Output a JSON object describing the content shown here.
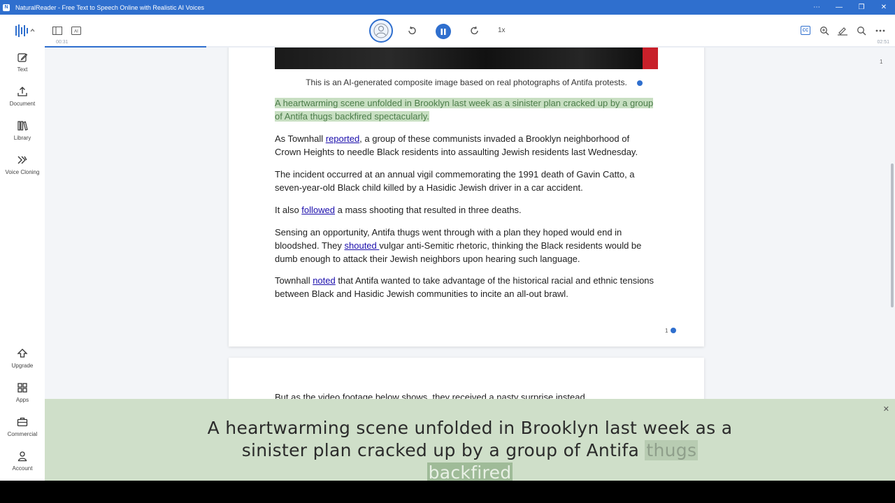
{
  "window": {
    "title": "NaturalReader - Free Text to Speech Online with Realistic AI Voices",
    "app_icon": "N",
    "controls": [
      "⋯",
      "—",
      "❐",
      "✕"
    ]
  },
  "toolbar": {
    "time_elapsed": "00:31",
    "time_total": "02:51",
    "speed": "1x",
    "cc_label": "CC",
    "ai_label": "AI",
    "progress_percent": 19
  },
  "sidebar": {
    "items": [
      {
        "label": "Text",
        "icon": "✎"
      },
      {
        "label": "Document",
        "icon": "⇪"
      },
      {
        "label": "Library",
        "icon": "▥"
      },
      {
        "label": "Voice Cloning",
        "icon": "≫"
      }
    ],
    "bottom_items": [
      {
        "label": "Upgrade",
        "icon": "⇧"
      },
      {
        "label": "Apps",
        "icon": "▦"
      },
      {
        "label": "Commercial",
        "icon": "▣"
      },
      {
        "label": "Account",
        "icon": "◯"
      }
    ]
  },
  "document": {
    "caption": "This is an AI-generated composite image based on real photographs of Antifa protests.",
    "paragraphs": [
      {
        "text": "A heartwarming scene unfolded in Brooklyn last week as a sinister plan cracked up by a group of Antifa thugs backfired spectacularly."
      },
      {
        "pre": "As Townhall ",
        "link": "reported",
        "post": ", a group of these communists invaded a Brooklyn neighborhood of Crown Heights to needle Black residents into assaulting Jewish residents last Wednesday."
      },
      {
        "text": "The incident occurred at an annual vigil commemorating the 1991 death of Gavin Catto, a seven-year-old Black child killed by a Hasidic Jewish driver in a car accident."
      },
      {
        "pre": "It also ",
        "link": "followed",
        "post": " a mass shooting that resulted in three deaths."
      },
      {
        "pre": "Sensing an opportunity, Antifa thugs went through with a plan they hoped would end in bloodshed. They ",
        "link": "shouted ",
        "post": "vulgar anti-Semitic rhetoric, thinking the Black residents would be dumb enough to attack their Jewish neighbors upon hearing such language."
      },
      {
        "pre": "Townhall ",
        "link": "noted",
        "post": " that Antifa wanted to take advantage of the historical racial and ethnic tensions between Black and Hasidic Jewish communities to incite an all-out brawl."
      }
    ],
    "page_number": "1",
    "side_page_number": "1",
    "page2_text": "But as the video footage below shows, they received a nasty surprise instead."
  },
  "overlay": {
    "line1": "A heartwarming scene unfolded in Brooklyn last week as a",
    "line2_pre": "sinister plan cracked up by a group of Antifa ",
    "word1": "thugs",
    "word2": "backfired",
    "close": "✕"
  },
  "colors": {
    "accent": "#2f6fce",
    "highlight_bg": "#c8dfc2",
    "overlay_bg": "#cfdfc9"
  }
}
